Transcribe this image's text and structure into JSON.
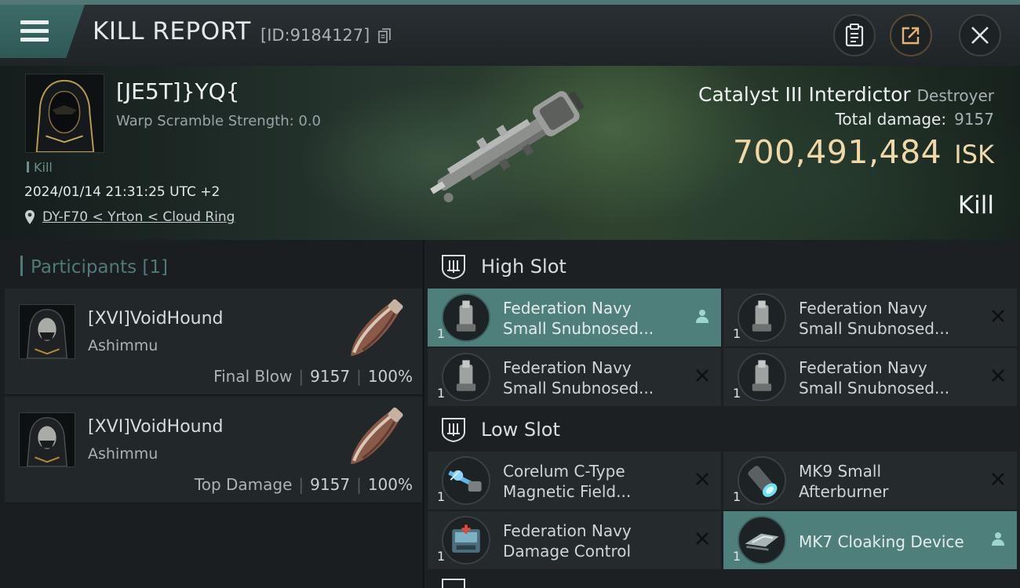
{
  "header": {
    "title": "KILL REPORT",
    "report_id": "[ID:9184127]"
  },
  "victim": {
    "name": "[JE5T]}YQ{",
    "warp_scramble": "Warp Scramble Strength: 0.0",
    "kill_tag": "Kill",
    "datetime": "2024/01/14 21:31:25 UTC +2",
    "location": "DY-F70 < Yrton < Cloud Ring",
    "ship_name": "Catalyst III Interdictor",
    "ship_class": "Destroyer",
    "total_damage_label": "Total damage:",
    "total_damage": "9157",
    "isk_value": "700,491,484",
    "isk_unit": "ISK",
    "result": "Kill"
  },
  "participants": {
    "label": "Participants",
    "count": "[1]",
    "rows": [
      {
        "name": "[XVI]VoidHound",
        "ship": "Ashimmu",
        "role": "Final Blow",
        "damage": "9157",
        "percent": "100%"
      },
      {
        "name": "[XVI]VoidHound",
        "ship": "Ashimmu",
        "role": "Top Damage",
        "damage": "9157",
        "percent": "100%"
      }
    ]
  },
  "fitting": {
    "high_slot": {
      "title": "High Slot",
      "modules": [
        {
          "line1": "Federation Navy",
          "line2": "Small Snubnosed...",
          "qty": "1",
          "status": "dropped"
        },
        {
          "line1": "Federation Navy",
          "line2": "Small Snubnosed...",
          "qty": "1",
          "status": "destroyed"
        },
        {
          "line1": "Federation Navy",
          "line2": "Small Snubnosed...",
          "qty": "1",
          "status": "destroyed"
        },
        {
          "line1": "Federation Navy",
          "line2": "Small Snubnosed...",
          "qty": "1",
          "status": "destroyed"
        }
      ]
    },
    "low_slot": {
      "title": "Low Slot",
      "modules": [
        {
          "line1": "Corelum C-Type",
          "line2": "Magnetic Field...",
          "qty": "1",
          "status": "destroyed"
        },
        {
          "line1": "MK9 Small",
          "line2": "Afterburner",
          "qty": "1",
          "status": "destroyed"
        },
        {
          "line1": "Federation Navy",
          "line2": "Damage Control",
          "qty": "1",
          "status": "destroyed"
        },
        {
          "line1": "MK7 Cloaking Device",
          "line2": "",
          "qty": "1",
          "status": "dropped"
        }
      ]
    }
  },
  "colors": {
    "accent": "#4f7f7b",
    "isk": "#f0d8a8"
  }
}
